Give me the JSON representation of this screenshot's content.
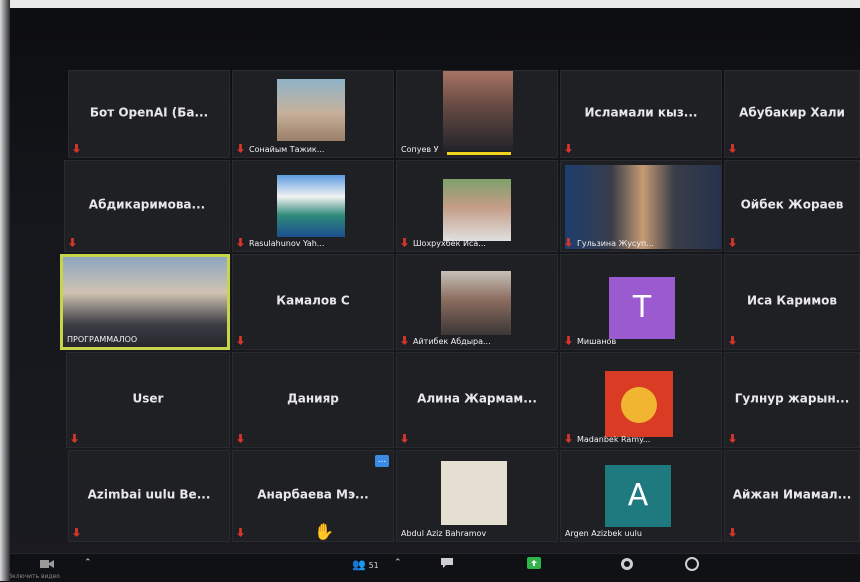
{
  "tiles": [
    {
      "id": "r1c1",
      "name": "Бот OpenAI (Ба..."
    },
    {
      "id": "r1c2",
      "label": "Сонайым Тажик..."
    },
    {
      "id": "r1c3",
      "label": "Сопуев У"
    },
    {
      "id": "r1c4",
      "name": "Исламали кыз..."
    },
    {
      "id": "r1c5",
      "name": "Абубакир Хали"
    },
    {
      "id": "r2c1",
      "name": "Абдикаримова..."
    },
    {
      "id": "r2c2",
      "label": "Rasulahunov Yah..."
    },
    {
      "id": "r2c3",
      "label": "Шохрухбек Иса..."
    },
    {
      "id": "r2c4",
      "label": "Гульзина Жусуп..."
    },
    {
      "id": "r2c5",
      "name": "Ойбек Жораев"
    },
    {
      "id": "r3c1",
      "label": "ПРОГРАММАЛОО"
    },
    {
      "id": "r3c2",
      "name": "Камалов С"
    },
    {
      "id": "r3c3",
      "label": "Айтибек Абдыра..."
    },
    {
      "id": "r3c4",
      "label": "Мишанов",
      "avatar": "T"
    },
    {
      "id": "r3c5",
      "name": "Иса Каримов"
    },
    {
      "id": "r4c1",
      "name": "User"
    },
    {
      "id": "r4c2",
      "name": "Данияр"
    },
    {
      "id": "r4c3",
      "name": "Алина Жармам..."
    },
    {
      "id": "r4c4",
      "label": "Madanbek Ramy..."
    },
    {
      "id": "r4c5",
      "name": "Гулнур жарын..."
    },
    {
      "id": "r5c1",
      "name": "Azimbai uulu Be..."
    },
    {
      "id": "r5c2",
      "name": "Анарбаева Мэ..."
    },
    {
      "id": "r5c3",
      "label": "Abdul Aziz Bahramov"
    },
    {
      "id": "r5c4",
      "label": "Argen Azizbek uulu",
      "avatar": "A"
    },
    {
      "id": "r5c5",
      "name": "Айжан Имамал..."
    }
  ],
  "toolbar": {
    "video_label": "Включить видео",
    "participants_count": "51",
    "tile_badge": "..."
  },
  "colors": {
    "active_speaker": "#c8d44a",
    "muted_mic": "#d6352c",
    "avatar_t": "#9b5ad0",
    "avatar_a": "#1f7a80"
  }
}
